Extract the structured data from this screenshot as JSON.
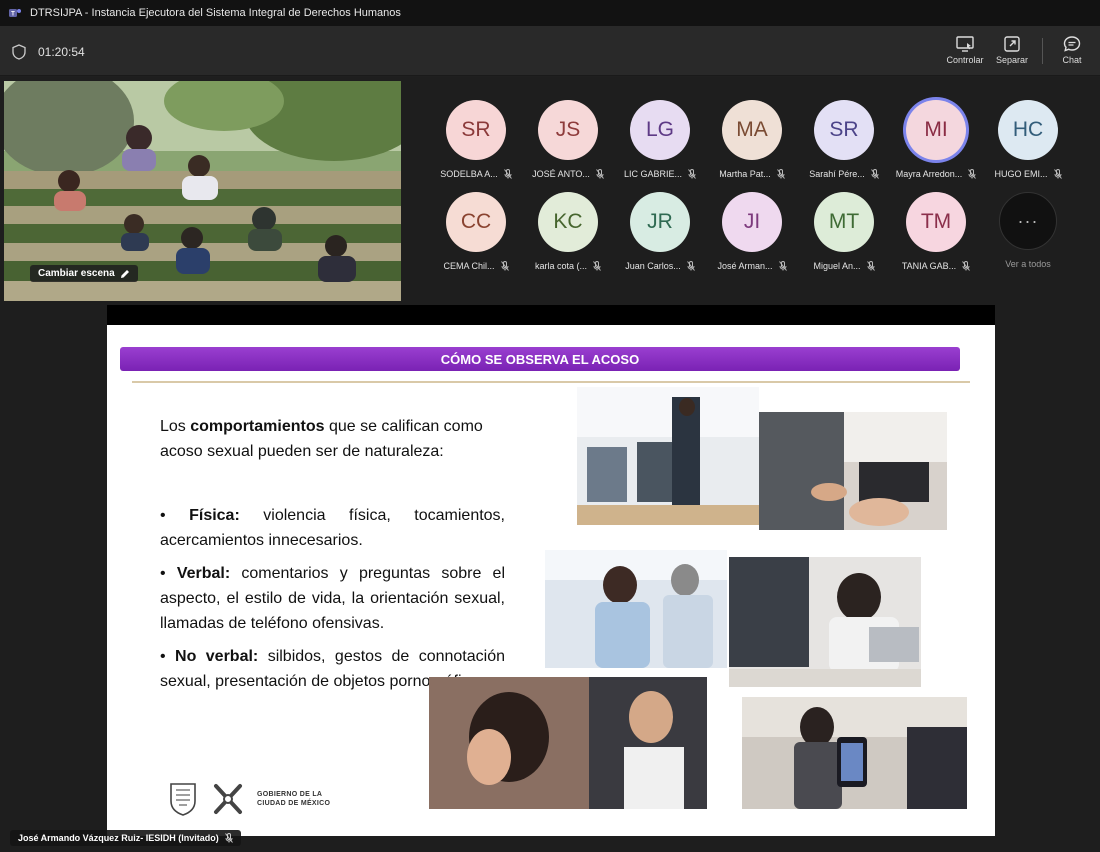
{
  "window": {
    "title": "DTRSIJPA - Instancia Ejecutora del Sistema Integral de Derechos Humanos"
  },
  "meeting": {
    "elapsed": "01:20:54"
  },
  "toolbar": {
    "control_label": "Controlar",
    "separate_label": "Separar",
    "chat_label": "Chat"
  },
  "video": {
    "scene_button": "Cambiar escena"
  },
  "participants": [
    {
      "initials": "SR",
      "name": "SODELBA A...",
      "bg": "#f7d6d6",
      "fg": "#8b3a3a"
    },
    {
      "initials": "JS",
      "name": "JOSÉ ANTO...",
      "bg": "#f6d8d8",
      "fg": "#8e3b3b"
    },
    {
      "initials": "LG",
      "name": "LIC GABRIE...",
      "bg": "#e7dcf2",
      "fg": "#5e3a86"
    },
    {
      "initials": "MA",
      "name": "Martha Pat...",
      "bg": "#efe0d6",
      "fg": "#7a4b33"
    },
    {
      "initials": "SR",
      "name": "Sarahí Pére...",
      "bg": "#e3e0f5",
      "fg": "#4c4489"
    },
    {
      "initials": "MI",
      "name": "Mayra Arredon...",
      "bg": "#f4d7de",
      "fg": "#8a2c44",
      "active": true
    },
    {
      "initials": "HC",
      "name": "HUGO EMI...",
      "bg": "#dde9f2",
      "fg": "#325d7a"
    },
    {
      "initials": "CC",
      "name": "CEMA Chil...",
      "bg": "#f6dcd4",
      "fg": "#8a4330"
    },
    {
      "initials": "KC",
      "name": "karla cota (...",
      "bg": "#e2ecd9",
      "fg": "#46652e"
    },
    {
      "initials": "JR",
      "name": "Juan Carlos...",
      "bg": "#d8ece3",
      "fg": "#2f6a52"
    },
    {
      "initials": "JI",
      "name": "José Arman...",
      "bg": "#efd9ef",
      "fg": "#7d3a7d"
    },
    {
      "initials": "MT",
      "name": "Miguel An...",
      "bg": "#ddecd8",
      "fg": "#3f6b35"
    },
    {
      "initials": "TM",
      "name": "TANIA GAB...",
      "bg": "#f7d6e0",
      "fg": "#8b2f4b"
    }
  ],
  "view_all": {
    "symbol": "···",
    "label": "Ver a todos"
  },
  "slide": {
    "header": "CÓMO SE OBSERVA EL ACOSO",
    "intro_pre": "Los ",
    "intro_bold": "comportamientos",
    "intro_post": " que se califican como acoso sexual pueden ser de naturaleza:",
    "bullets": [
      {
        "label": "Física:",
        "text": " violencia física, tocamientos, acercamientos innecesarios."
      },
      {
        "label": "Verbal:",
        "text": " comentarios y preguntas sobre el aspecto, el estilo de vida, la orientación sexual, llamadas de teléfono ofensivas."
      },
      {
        "label": "No verbal:",
        "text": " silbidos, gestos de connotación sexual, presentación de objetos pornográficos."
      }
    ],
    "gov_line1": "GOBIERNO DE LA",
    "gov_line2": "CIUDAD DE MÉXICO"
  },
  "presenter": {
    "name": "José Armando Vázquez Ruiz- IESIDH (Invitado)"
  },
  "colors": {
    "accent": "#7b83eb",
    "header_purple": "#7a22b4",
    "app_bg": "#1f1f1f"
  }
}
